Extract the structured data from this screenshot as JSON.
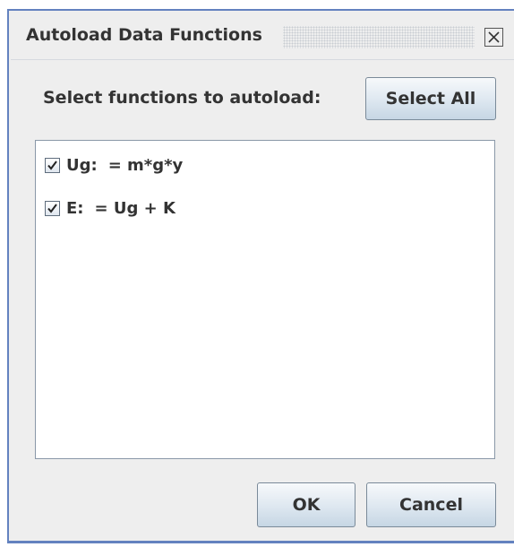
{
  "window": {
    "title": "Autoload Data Functions",
    "close_icon": "close-icon"
  },
  "prompt": {
    "label": "Select functions to autoload:",
    "select_all_label": "Select All"
  },
  "functions": [
    {
      "name": "Ug:",
      "expression": "= m*g*y",
      "checked": true
    },
    {
      "name": "E:",
      "expression": "= Ug + K",
      "checked": true
    }
  ],
  "footer": {
    "ok_label": "OK",
    "cancel_label": "Cancel"
  },
  "colors": {
    "window_border": "#6382bf",
    "background": "#eeeeee",
    "text": "#333333"
  }
}
